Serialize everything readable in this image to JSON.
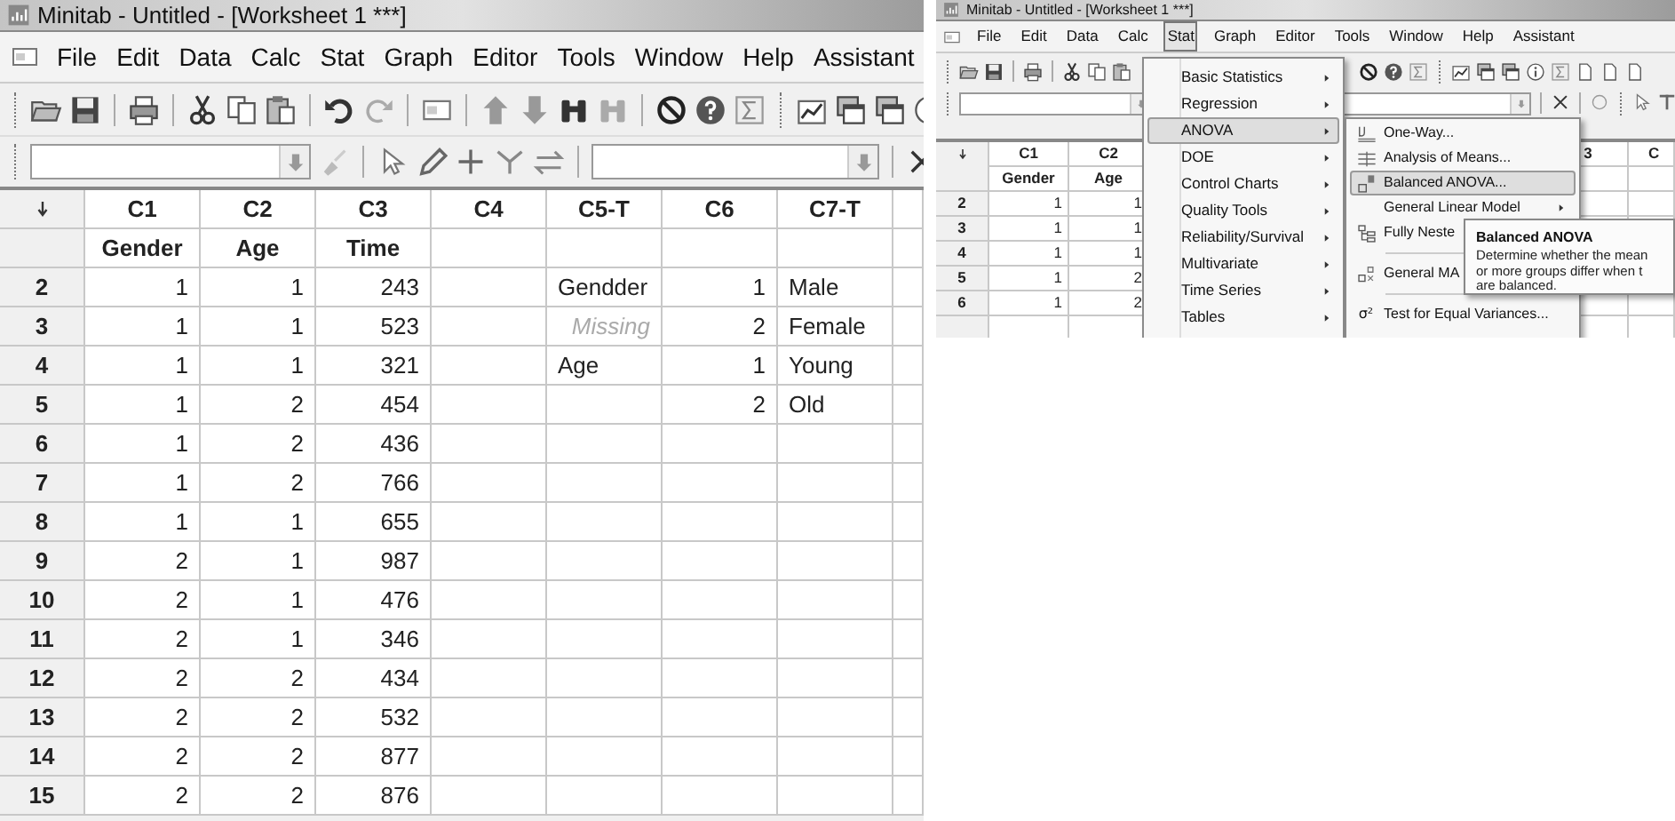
{
  "left_window": {
    "title": "Minitab - Untitled - [Worksheet 1 ***]",
    "menu": [
      "File",
      "Edit",
      "Data",
      "Calc",
      "Stat",
      "Graph",
      "Editor",
      "Tools",
      "Window",
      "Help",
      "Assistant"
    ],
    "worksheet": {
      "columns": [
        {
          "id": "C1",
          "name": "Gender",
          "kind": "numeric"
        },
        {
          "id": "C2",
          "name": "Age",
          "kind": "numeric"
        },
        {
          "id": "C3",
          "name": "Time",
          "kind": "numeric"
        },
        {
          "id": "C4"
        },
        {
          "id": "C5-T",
          "kind": "text"
        },
        {
          "id": "C6",
          "kind": "numeric"
        },
        {
          "id": "C7-T",
          "kind": "text"
        }
      ],
      "rows": [
        {
          "number": "2",
          "cells": [
            "1",
            "1",
            "243",
            null,
            "Gendder",
            "1",
            "Male"
          ]
        },
        {
          "number": "3",
          "cells": [
            "1",
            "1",
            "523",
            null,
            {
              "text": "Missing",
              "kind": "missing"
            },
            "2",
            "Female"
          ]
        },
        {
          "number": "4",
          "cells": [
            "1",
            "1",
            "321",
            null,
            "Age",
            "1",
            "Young"
          ]
        },
        {
          "number": "5",
          "cells": [
            "1",
            "2",
            "454",
            null,
            null,
            "2",
            "Old"
          ]
        },
        {
          "number": "6",
          "cells": [
            "1",
            "2",
            "436",
            null,
            null,
            null,
            null
          ]
        },
        {
          "number": "7",
          "cells": [
            "1",
            "2",
            "766",
            null,
            null,
            null,
            null
          ]
        },
        {
          "number": "8",
          "cells": [
            "1",
            "1",
            "655",
            null,
            null,
            null,
            null
          ]
        },
        {
          "number": "9",
          "cells": [
            "2",
            "1",
            "987",
            null,
            null,
            null,
            null
          ]
        },
        {
          "number": "10",
          "cells": [
            "2",
            "1",
            "476",
            null,
            null,
            null,
            null
          ]
        },
        {
          "number": "11",
          "cells": [
            "2",
            "1",
            "346",
            null,
            null,
            null,
            null
          ]
        },
        {
          "number": "12",
          "cells": [
            "2",
            "2",
            "434",
            null,
            null,
            null,
            null
          ]
        },
        {
          "number": "13",
          "cells": [
            "2",
            "2",
            "532",
            null,
            null,
            null,
            null
          ]
        },
        {
          "number": "14",
          "cells": [
            "2",
            "2",
            "877",
            null,
            null,
            null,
            null
          ]
        },
        {
          "number": "15",
          "cells": [
            "2",
            "2",
            "876",
            null,
            null,
            null,
            null
          ]
        }
      ]
    }
  },
  "right_window": {
    "title": "Minitab - Untitled - [Worksheet 1 ***]",
    "menu": [
      {
        "label": "File",
        "selected": false
      },
      {
        "label": "Edit",
        "selected": false
      },
      {
        "label": "Data",
        "selected": false
      },
      {
        "label": "Calc",
        "selected": false
      },
      {
        "label": "Stat",
        "selected": true
      },
      {
        "label": "Graph",
        "selected": false
      },
      {
        "label": "Editor",
        "selected": false
      },
      {
        "label": "Tools",
        "selected": false
      },
      {
        "label": "Window",
        "selected": false
      },
      {
        "label": "Help",
        "selected": false
      },
      {
        "label": "Assistant",
        "selected": false
      }
    ],
    "worksheet": {
      "columns": [
        {
          "id": "C1",
          "name": "Gender"
        },
        {
          "id": "C2",
          "name": "Age"
        }
      ],
      "partly_hidden_headers": [
        "3",
        "C"
      ],
      "rows": [
        {
          "number": "2",
          "cells": [
            "1",
            "1"
          ]
        },
        {
          "number": "3",
          "cells": [
            "1",
            "1"
          ]
        },
        {
          "number": "4",
          "cells": [
            "1",
            "1"
          ]
        },
        {
          "number": "5",
          "cells": [
            "1",
            "2"
          ]
        },
        {
          "number": "6",
          "cells": [
            "1",
            "2"
          ]
        }
      ]
    },
    "stat_menu": [
      {
        "label": "Basic Statistics",
        "selected": false
      },
      {
        "label": "Regression",
        "selected": false
      },
      {
        "label": "ANOVA",
        "selected": true
      },
      {
        "label": "DOE",
        "selected": false
      },
      {
        "label": "Control Charts",
        "selected": false
      },
      {
        "label": "Quality Tools",
        "selected": false
      },
      {
        "label": "Reliability/Survival",
        "selected": false
      },
      {
        "label": "Multivariate",
        "selected": false
      },
      {
        "label": "Time Series",
        "selected": false
      },
      {
        "label": "Tables",
        "selected": false
      }
    ],
    "anova_submenu": [
      {
        "kind": "item",
        "label": "One-Way...",
        "selected": false
      },
      {
        "kind": "item",
        "label": "Analysis of Means...",
        "selected": false
      },
      {
        "kind": "item",
        "label": "Balanced ANOVA...",
        "selected": true
      },
      {
        "kind": "item",
        "label": "General Linear Model",
        "selected": false,
        "has_submenu": true
      },
      {
        "kind": "item",
        "label": "Fully Neste",
        "selected": false
      },
      {
        "kind": "separator"
      },
      {
        "kind": "item",
        "label": "General MA",
        "selected": false
      },
      {
        "kind": "separator"
      },
      {
        "kind": "item",
        "label": "Test for Equal Variances...",
        "selected": false,
        "glyph": "σ²"
      }
    ],
    "tooltip": {
      "title": "Balanced ANOVA",
      "lines": [
        "Determine whether the mean",
        "or more groups differ when t",
        "are balanced."
      ]
    }
  }
}
